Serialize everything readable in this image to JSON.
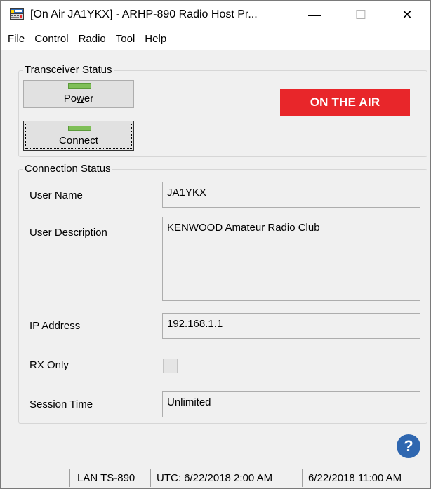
{
  "window": {
    "title": "[On Air JA1YKX] - ARHP-890 Radio Host Pr...",
    "minimize_glyph": "—",
    "maximize_glyph": "☐",
    "close_glyph": "✕",
    "app_icon": "radio-host-icon"
  },
  "menu": {
    "items": [
      {
        "accel": "F",
        "rest": "ile"
      },
      {
        "accel": "C",
        "rest": "ontrol"
      },
      {
        "accel": "R",
        "rest": "adio"
      },
      {
        "accel": "T",
        "rest": "ool"
      },
      {
        "accel": "H",
        "rest": "elp"
      }
    ]
  },
  "transceiver": {
    "group_title": "Transceiver Status",
    "power": {
      "pre": "Po",
      "accel": "w",
      "post": "er",
      "led_color": "#7fbf58"
    },
    "connect": {
      "pre": "Co",
      "accel": "n",
      "post": "nect",
      "led_color": "#7fbf58"
    },
    "status_banner": "ON THE AIR",
    "banner_color": "#e8262a"
  },
  "connection": {
    "group_title": "Connection Status",
    "user_name_label": "User Name",
    "user_name_value": "JA1YKX",
    "user_description_label": "User Description",
    "user_description_value": "KENWOOD Amateur Radio Club",
    "ip_address_label": "IP Address",
    "ip_address_value": "192.168.1.1",
    "rx_only_label": "RX Only",
    "rx_only_checked": false,
    "session_time_label": "Session Time",
    "session_time_value": "Unlimited"
  },
  "help": {
    "glyph": "?",
    "icon": "help-icon",
    "color": "#2f67b0"
  },
  "statusbar": {
    "device": "LAN TS-890",
    "utc": "UTC: 6/22/2018 2:00 AM",
    "local": "6/22/2018 11:00 AM"
  }
}
